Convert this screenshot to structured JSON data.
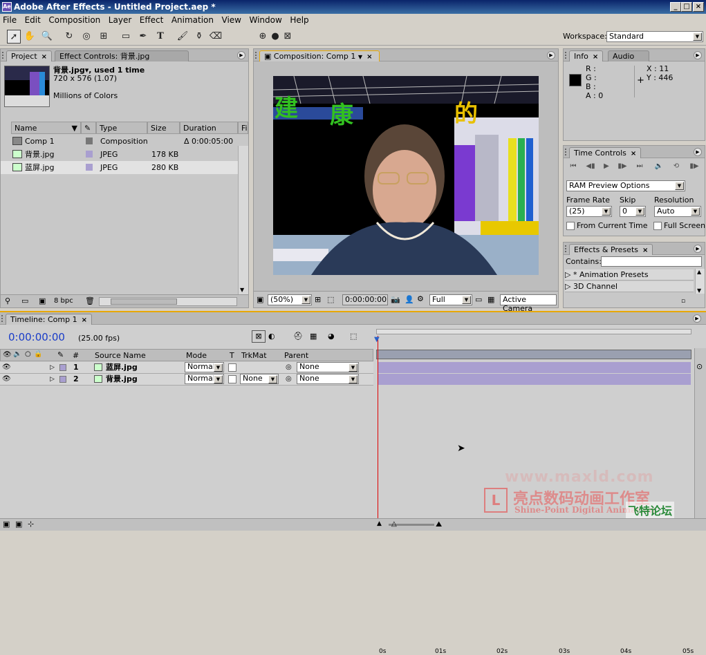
{
  "window": {
    "title": "Adobe After Effects - Untitled Project.aep *",
    "min": "_",
    "max": "□",
    "close": "×"
  },
  "menu": [
    "File",
    "Edit",
    "Composition",
    "Layer",
    "Effect",
    "Animation",
    "View",
    "Window",
    "Help"
  ],
  "workspace": {
    "label": "Workspace:",
    "value": "Standard"
  },
  "project": {
    "tab": "Project",
    "effect_tab": "Effect Controls: 背景.jpg",
    "selected_name": "背景.jpg▾, used 1 time",
    "dims": "720 x 576 (1.07)",
    "colors": "Millions of Colors",
    "columns": [
      "Name",
      "Type",
      "Size",
      "Duration",
      "File"
    ],
    "items": [
      {
        "name": "Comp 1",
        "type": "Composition",
        "size": "",
        "duration": "Δ 0:00:05:00"
      },
      {
        "name": "背景.jpg",
        "type": "JPEG",
        "size": "178 KB",
        "duration": ""
      },
      {
        "name": "蓝屏.jpg",
        "type": "JPEG",
        "size": "280 KB",
        "duration": ""
      }
    ],
    "bpc": "8 bpc"
  },
  "composition": {
    "tab": "Composition: Comp 1",
    "zoom": "(50%)",
    "timecode": "0:00:00:00",
    "quality": "Full",
    "camera": "Active Camera"
  },
  "info": {
    "tab": "Info",
    "audio_tab": "Audio",
    "r": "R :",
    "g": "G :",
    "b": "B :",
    "a": "A : 0",
    "x": "X : 11",
    "y": "Y : 446"
  },
  "time_controls": {
    "tab": "Time Controls",
    "ram_preview": "RAM Preview Options",
    "frame_rate_label": "Frame Rate",
    "frame_rate": "(25)",
    "skip_label": "Skip",
    "skip": "0",
    "resolution_label": "Resolution",
    "resolution": "Auto",
    "from_current": "From Current Time",
    "full_screen": "Full Screen"
  },
  "effects": {
    "tab": "Effects & Presets",
    "contains_label": "Contains:",
    "items": [
      "* Animation Presets",
      "3D Channel"
    ]
  },
  "timeline": {
    "tab": "Timeline: Comp 1",
    "timecode": "0:00:00:00",
    "fps": "(25.00 fps)",
    "columns": {
      "num": "#",
      "source": "Source Name",
      "mode": "Mode",
      "t": "T",
      "trkmat": "TrkMat",
      "parent": "Parent"
    },
    "layers": [
      {
        "num": "1",
        "name": "蓝屏.jpg",
        "mode": "Normal",
        "trkmat": "",
        "parent": "None"
      },
      {
        "num": "2",
        "name": "背景.jpg",
        "mode": "Normal",
        "trkmat": "None",
        "parent": "None"
      }
    ],
    "ruler": [
      "0s",
      "01s",
      "02s",
      "03s",
      "04s",
      "05s"
    ]
  },
  "watermark": {
    "url": "www.maxld.com",
    "cn": "亮点数码动画工作室",
    "en": "Shine-Point Digital Animation",
    "corner": "飞特论坛"
  },
  "colors": {
    "accent": "#e8a800",
    "title_blue": "#0a246a",
    "timecode": "#1a3cc8",
    "layer_bar": "#a99fd0"
  }
}
